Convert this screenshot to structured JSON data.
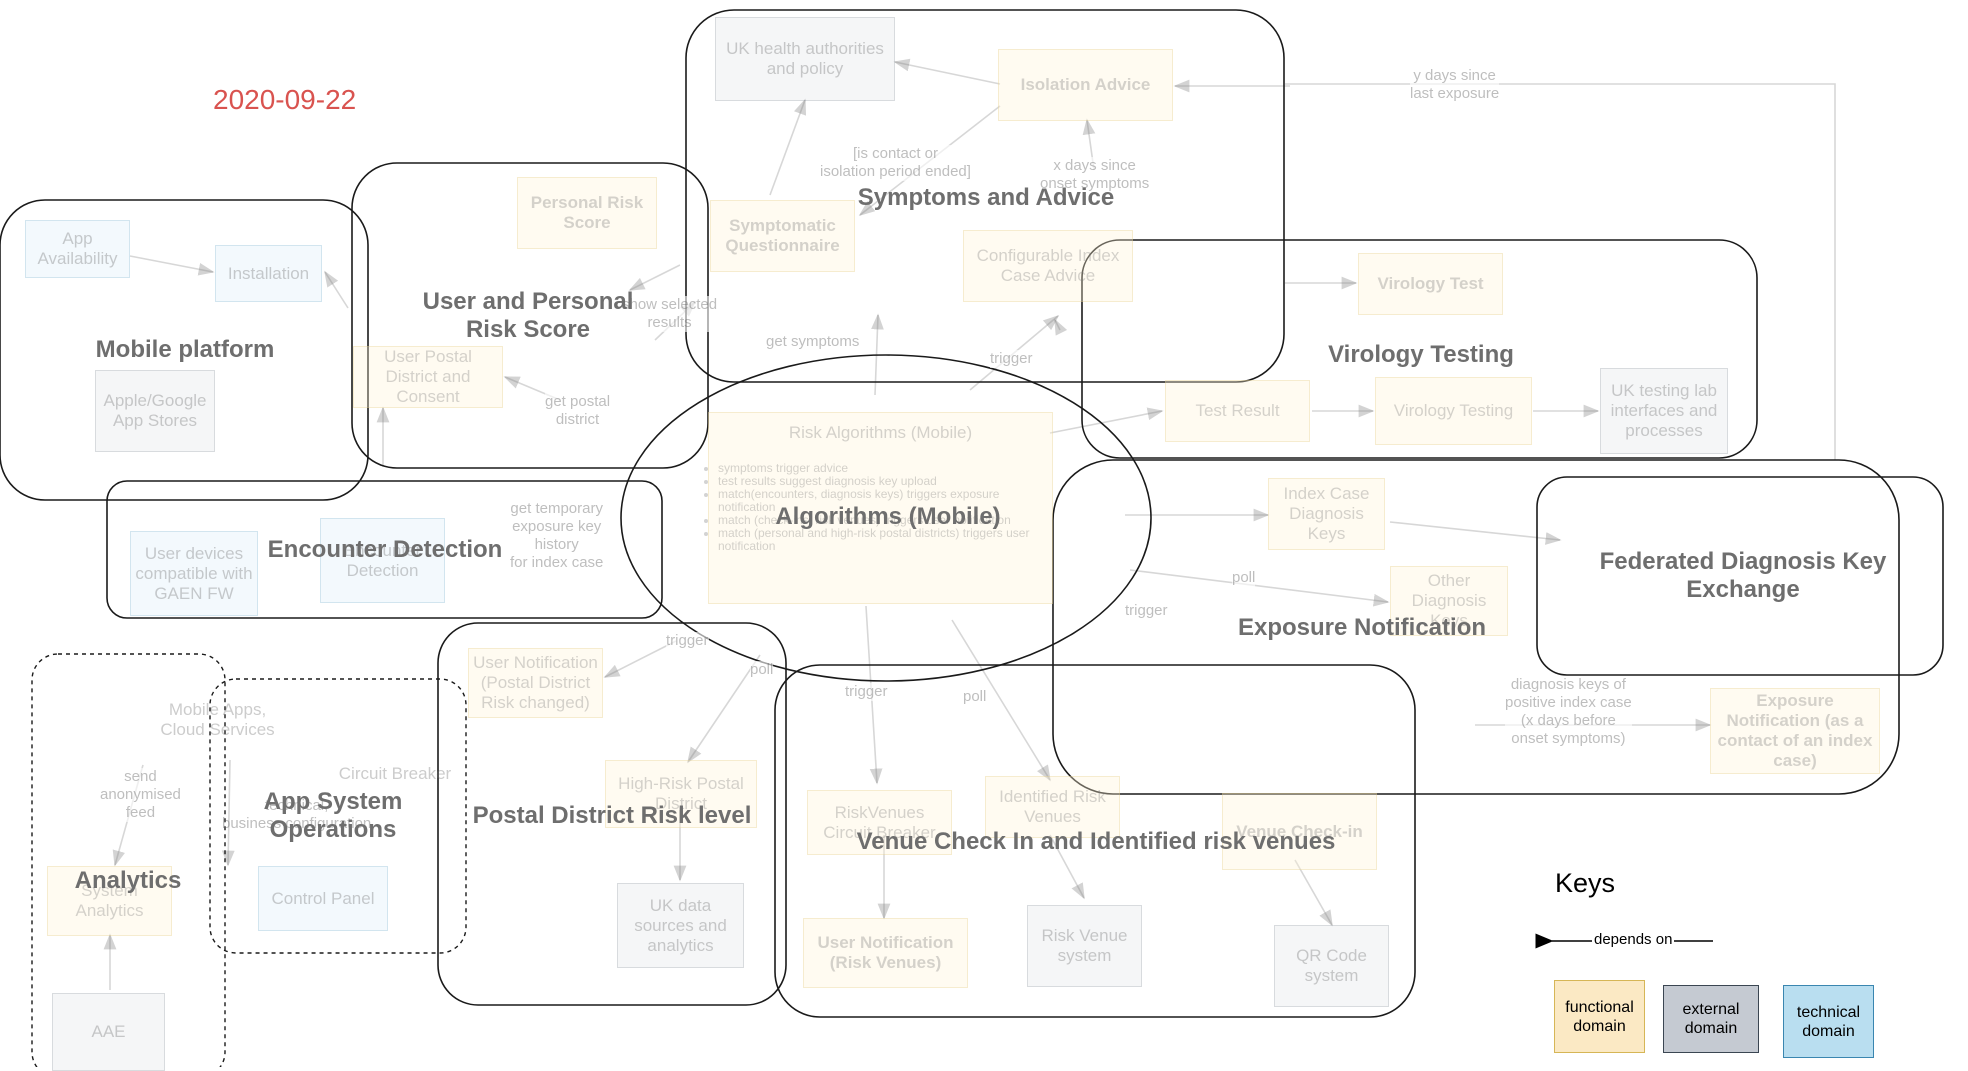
{
  "date": "2020-09-22",
  "groups": {
    "mobile_platform": "Mobile platform",
    "user_risk": "User and Personal Risk Score",
    "symptoms": "Symptoms and Advice",
    "virology": "Virology Testing",
    "algorithms": "Algorithms (Mobile)",
    "encounter": "Encounter Detection",
    "federated": "Federated Diagnosis Key Exchange",
    "exposure": "Exposure Notification",
    "analytics": "Analytics",
    "app_ops": "App System Operations",
    "postal": "Postal District Risk level",
    "venue": "Venue Check In and Identified risk venues"
  },
  "nodes": {
    "app_availability": "App Availability",
    "installation": "Installation",
    "app_stores": "Apple/Google App Stores",
    "personal_risk_score": "Personal Risk Score",
    "user_postal": "User Postal District and Consent",
    "uk_health": "UK health authorities and policy",
    "isolation_advice": "Isolation Advice",
    "symptomatic_q": "Symptomatic Questionnaire",
    "configurable_index": "Configurable Index Case Advice",
    "virology_test": "Virology Test",
    "test_result": "Test Result",
    "virology_testing": "Virology Testing",
    "uk_testing_lab": "UK testing lab interfaces and processes",
    "risk_algorithms": "Risk Algorithms (Mobile)",
    "user_devices": "User devices compatible with GAEN FW",
    "encounter_detection": "Encounter Detection",
    "index_case_keys": "Index Case Diagnosis Keys",
    "other_diagnosis_keys": "Other Diagnosis Keys",
    "exposure_notif_index": "Exposure Notification (as a contact of an index case)",
    "mobile_apps_cloud": "Mobile Apps, Cloud Services",
    "system_analytics": "System Analytics",
    "aae": "AAE",
    "circuit_breaker": "Circuit Breaker",
    "control_panel": "Control Panel",
    "user_notif_postal": "User Notification (Postal District Risk changed)",
    "high_risk_postal": "High-Risk Postal District",
    "uk_data_sources": "UK data sources and analytics",
    "riskvenues_cb": "RiskVenues Circuit Breaker",
    "identified_risk_venues": "Identified Risk Venues",
    "venue_checkin": "Venue Check-in",
    "user_notif_venues": "User Notification (Risk Venues)",
    "risk_venue_system": "Risk Venue system",
    "qr_code_system": "QR Code system"
  },
  "algo_bullets": [
    "symptoms trigger advice",
    "test results suggest diagnosis key upload",
    "match(encounters, diagnosis keys) triggers exposure notification",
    "match (check-ins, risk venues) triggers user notification",
    "match (personal and high-risk postal districts) triggers user notification"
  ],
  "edge_labels": {
    "y_days": "y days since\nlast exposure",
    "is_contact": "[is contact or\nisolation period ended]",
    "x_days": "x days since\nonset symptoms",
    "show_selected": "show selected\nresults",
    "get_symptoms": "get symptoms",
    "trigger_1": "trigger",
    "get_postal": "get postal\ndistrict",
    "get_temp_keys": "get temporary\nexposure key\nhistory\nfor index case",
    "poll_1": "poll",
    "trigger_2": "trigger",
    "trigger_3": "trigger",
    "poll_2": "poll",
    "trigger_4": "trigger",
    "poll_3": "poll",
    "diagnosis_keys_positive": "diagnosis keys of\npositive index case\n(x days before\nonset symptoms)",
    "send_anonymised": "send\nanonymised\nfeed",
    "technical_business": "technical,\nbusiness configuration"
  },
  "keys": {
    "title": "Keys",
    "depends_on": "depends on",
    "functional": "functional domain",
    "external": "external domain",
    "technical": "technical domain"
  },
  "colors": {
    "date": "#d9534f",
    "functional": "#fbe9c4",
    "external": "#c5cad2",
    "technical": "#b9def0"
  }
}
